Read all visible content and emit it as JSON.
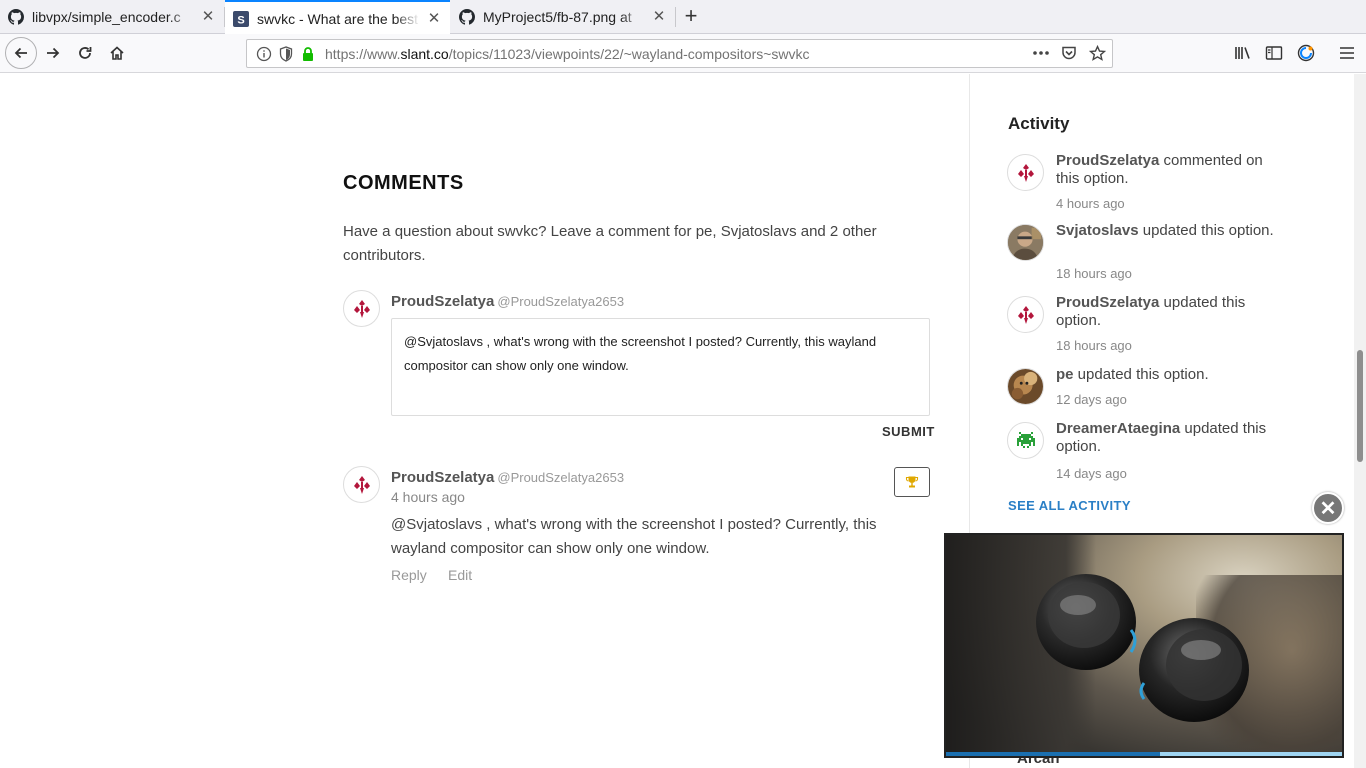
{
  "browser": {
    "tabs": [
      {
        "title": "libvpx/simple_encoder.c",
        "icon": "github-icon",
        "active": false
      },
      {
        "title": "swvkc - What are the best",
        "icon": "slant-icon",
        "active": true
      },
      {
        "title": "MyProject5/fb-87.png at",
        "icon": "github-icon",
        "active": false
      }
    ],
    "url_prefix": "https://www.",
    "url_domain": "slant.co",
    "url_path": "/topics/11023/viewpoints/22/~wayland-compositors~swvkc"
  },
  "comments": {
    "heading": "COMMENTS",
    "intro": "Have a question about swvkc? Leave a comment for pe, Svjatoslavs and 2 other contributors.",
    "composer": {
      "name": "ProudSzelatya",
      "handle": "@ProudSzelatya2653",
      "text": "@Svjatoslavs , what's wrong with the screenshot I posted? Currently, this wayland compositor can show only one window.",
      "submit_label": "SUBMIT"
    },
    "items": [
      {
        "name": "ProudSzelatya",
        "handle": "@ProudSzelatya2653",
        "time": "4 hours ago",
        "body": "@Svjatoslavs , what's wrong with the screenshot I posted? Currently, this wayland compositor can show only one window.",
        "reply_label": "Reply",
        "edit_label": "Edit"
      }
    ]
  },
  "activity": {
    "heading": "Activity",
    "items": [
      {
        "user": "ProudSzelatya",
        "action": " commented on this option.",
        "time": "4 hours ago",
        "avatar": "proudszelatya-logo"
      },
      {
        "user": "Svjatoslavs",
        "action": " updated this option.",
        "time": "18 hours ago",
        "avatar": "svjatoslavs-photo"
      },
      {
        "user": "ProudSzelatya",
        "action": " updated this option.",
        "time": "18 hours ago",
        "avatar": "proudszelatya-logo"
      },
      {
        "user": "pe",
        "action": " updated this option.",
        "time": "12 days ago",
        "avatar": "pe-photo"
      },
      {
        "user": "DreamerAtaegina",
        "action": " updated this option.",
        "time": "14 days ago",
        "avatar": "dreamerataegina-invader"
      }
    ],
    "see_all_label": "SEE ALL ACTIVITY"
  },
  "video": {
    "close_label": "✕",
    "progress_fraction": 0.54
  },
  "bottom_peek": "Arcan",
  "colors": {
    "accent_link": "#2a7fc6",
    "logo_red": "#b3163c",
    "invader_green": "#2aa13a",
    "tab_active": "#0a84ff",
    "lock_green": "#12bc00"
  }
}
